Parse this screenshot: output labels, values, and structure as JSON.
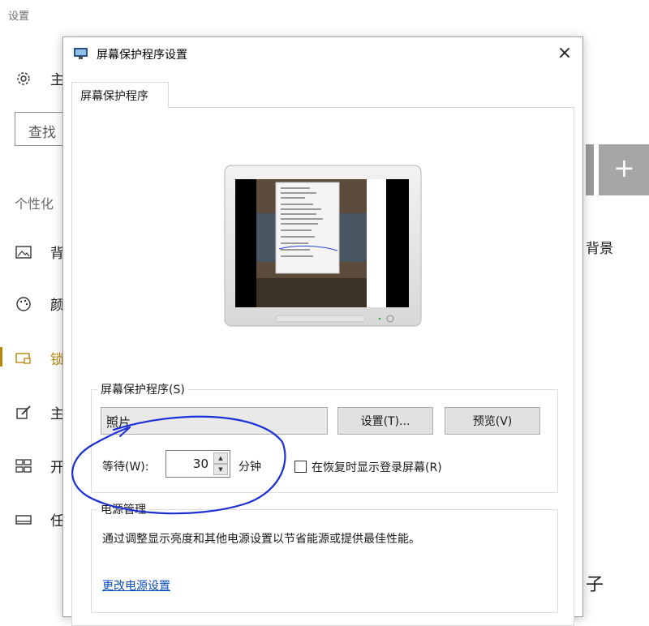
{
  "background": {
    "title": "设置",
    "search_text": "查找",
    "section_label": "个性化",
    "nav_items": [
      {
        "label": "主",
        "icon": "gear-icon"
      },
      {
        "label": "背",
        "icon": "picture-icon"
      },
      {
        "label": "颜",
        "icon": "palette-icon"
      },
      {
        "label": "锁",
        "icon": "lock-screen-icon"
      },
      {
        "label": "主",
        "icon": "theme-brush-icon"
      },
      {
        "label": "开",
        "icon": "start-grid-icon"
      },
      {
        "label": "任",
        "icon": "taskbar-icon"
      }
    ],
    "plus_label": "+",
    "right_text_1": "背景",
    "right_text_2": "子"
  },
  "dialog": {
    "title": "屏幕保护程序设置",
    "close_label": "×",
    "tab_label": "屏幕保护程序",
    "screensaver": {
      "group_label": "屏幕保护程序(S)",
      "selected": "照片",
      "settings_button": "设置(T)...",
      "preview_button": "预览(V)",
      "wait_label": "等待(W):",
      "wait_value": "30",
      "wait_unit": "分钟",
      "resume_checkbox_label": "在恢复时显示登录屏幕(R)",
      "resume_checked": false
    },
    "power": {
      "group_label": "电源管理",
      "description": "通过调整显示亮度和其他电源设置以节省能源或提供最佳性能。",
      "link": "更改电源设置"
    }
  },
  "colors": {
    "accent": "#b8860b",
    "link": "#0a4fbf",
    "annotation": "#1a2fd6"
  }
}
